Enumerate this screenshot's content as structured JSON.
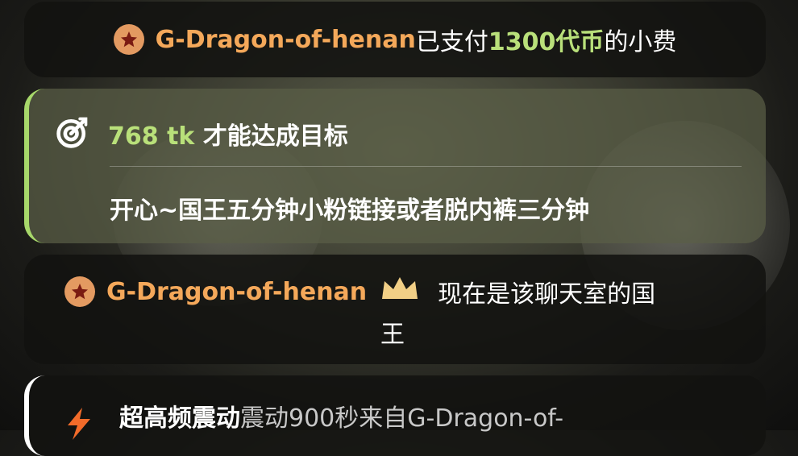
{
  "tip": {
    "user": "G-Dragon-of-henan",
    "action": "已支付",
    "amount": "1300代币",
    "suffix": "的小费"
  },
  "goal": {
    "amount": "768 tk",
    "label": "才能达成目标",
    "description": "开心~国王五分钟小粉链接或者脱内裤三分钟"
  },
  "king": {
    "user": "G-Dragon-of-henan",
    "text_line1": "现在是该聊天室的国",
    "text_line2": "王"
  },
  "vibration": {
    "title": "超高频震动",
    "detail": "震动900秒来自G-Dragon-of-"
  },
  "colors": {
    "username": "#f4a85a",
    "goal_green": "#b9e07a",
    "goal_bar": "#a7d86a",
    "badge": "#e39a61"
  }
}
